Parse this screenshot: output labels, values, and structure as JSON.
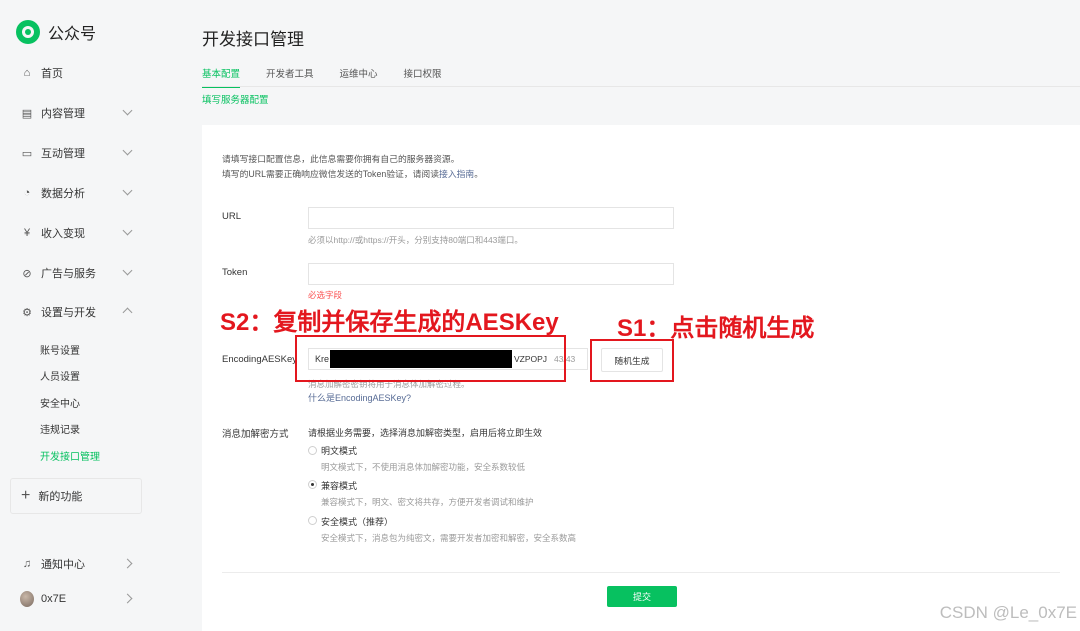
{
  "app": {
    "name": "公众号"
  },
  "sidebar": {
    "items": [
      {
        "label": "首页",
        "icon": "home-icon"
      },
      {
        "label": "内容管理",
        "icon": "document-icon"
      },
      {
        "label": "互动管理",
        "icon": "chat-icon"
      },
      {
        "label": "数据分析",
        "icon": "pie-chart-icon"
      },
      {
        "label": "收入变现",
        "icon": "money-icon"
      },
      {
        "label": "广告与服务",
        "icon": "compass-icon"
      },
      {
        "label": "设置与开发",
        "icon": "gear-icon"
      }
    ],
    "sub_items": [
      "账号设置",
      "人员设置",
      "安全中心",
      "违规记录",
      "开发接口管理"
    ],
    "new_function": "新的功能",
    "notification": "通知中心",
    "user": "0x7E"
  },
  "main": {
    "title": "开发接口管理",
    "tabs": [
      "基本配置",
      "开发者工具",
      "运维中心",
      "接口权限"
    ],
    "sublink": "填写服务器配置",
    "intro_line1": "请填写接口配置信息，此信息需要你拥有自己的服务器资源。",
    "intro_line2_pre": "填写的URL需要正确响应微信发送的Token验证，请阅读",
    "intro_link": "接入指南",
    "intro_line2_post": "。",
    "url": {
      "label": "URL",
      "value": "",
      "hint": "必须以http://或https://开头，分别支持80端口和443端口。"
    },
    "token": {
      "label": "Token",
      "value": "",
      "error": "必选字段"
    },
    "aes": {
      "label": "EncodingAESKey",
      "value_prefix": "Kre",
      "value_suffix": "VZPOPJ",
      "count": "43/43",
      "random_button": "随机生成",
      "hint": "消息加解密密钥将用于消息体加解密过程。",
      "link": "什么是EncodingAESKey?"
    },
    "mode": {
      "label": "消息加解密方式",
      "description": "请根据业务需要，选择消息加解密类型，启用后将立即生效",
      "options": [
        {
          "label": "明文模式",
          "desc": "明文模式下，不使用消息体加解密功能，安全系数较低",
          "checked": false
        },
        {
          "label": "兼容模式",
          "desc": "兼容模式下，明文、密文将共存，方便开发者调试和维护",
          "checked": true
        },
        {
          "label": "安全模式（推荐）",
          "desc": "安全模式下，消息包为纯密文，需要开发者加密和解密，安全系数高",
          "checked": false
        }
      ]
    },
    "submit": "提交"
  },
  "annotations": {
    "s2": "S2：复制并保存生成的AESKey",
    "s1": "S1：点击随机生成"
  },
  "watermark": "CSDN @Le_0x7E",
  "colors": {
    "accent": "#07c160",
    "annotation": "#e3171e",
    "link": "#576b95",
    "error": "#fa5151"
  }
}
